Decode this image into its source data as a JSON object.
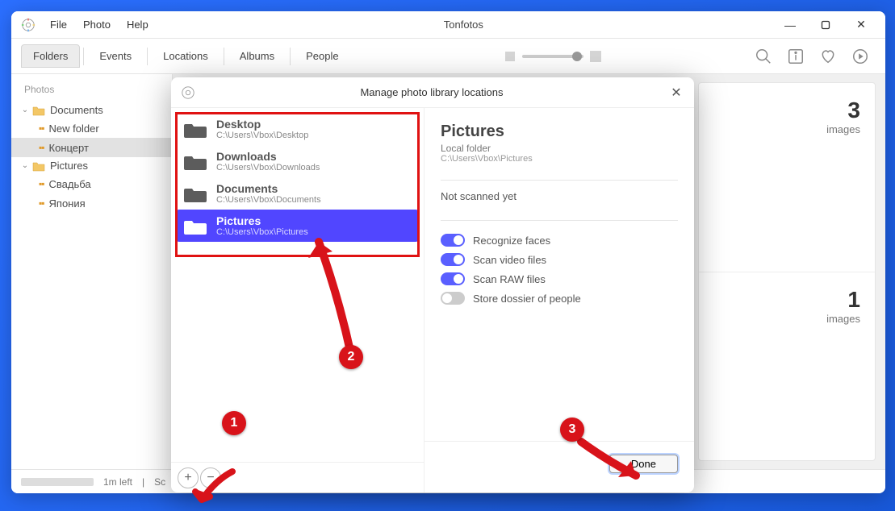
{
  "app": {
    "title": "Tonfotos",
    "menu": [
      "File",
      "Photo",
      "Help"
    ]
  },
  "tabs": {
    "items": [
      "Folders",
      "Events",
      "Locations",
      "Albums",
      "People"
    ],
    "active": 0
  },
  "sidebar": {
    "title": "Photos",
    "folders": [
      {
        "name": "Documents",
        "expanded": true,
        "children": [
          {
            "name": "New folder",
            "active": false
          },
          {
            "name": "Концерт",
            "active": true
          }
        ]
      },
      {
        "name": "Pictures",
        "expanded": true,
        "children": [
          {
            "name": "Свадьба",
            "active": false
          },
          {
            "name": "Япония",
            "active": false
          }
        ]
      }
    ]
  },
  "cards": [
    {
      "count": "3",
      "label": "images"
    },
    {
      "count": "1",
      "label": "images"
    }
  ],
  "status": {
    "time": "1m left",
    "scan": "Sc"
  },
  "modal": {
    "title": "Manage photo library locations",
    "locations": [
      {
        "name": "Desktop",
        "path": "C:\\Users\\Vbox\\Desktop",
        "selected": false
      },
      {
        "name": "Downloads",
        "path": "C:\\Users\\Vbox\\Downloads",
        "selected": false
      },
      {
        "name": "Documents",
        "path": "C:\\Users\\Vbox\\Documents",
        "selected": false
      },
      {
        "name": "Pictures",
        "path": "C:\\Users\\Vbox\\Pictures",
        "selected": true
      }
    ],
    "details": {
      "name": "Pictures",
      "type": "Local folder",
      "path": "C:\\Users\\Vbox\\Pictures",
      "status": "Not scanned yet",
      "toggles": [
        {
          "label": "Recognize faces",
          "on": true
        },
        {
          "label": "Scan video files",
          "on": true
        },
        {
          "label": "Scan RAW files",
          "on": true
        },
        {
          "label": "Store dossier of people",
          "on": false
        }
      ],
      "done": "Done"
    }
  },
  "annotations": [
    "1",
    "2",
    "3"
  ]
}
